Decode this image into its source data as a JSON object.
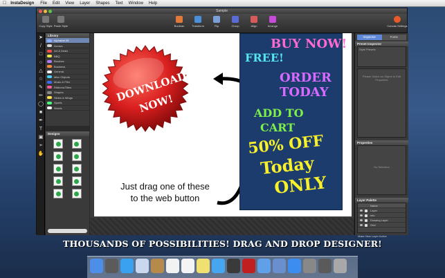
{
  "menubar": {
    "app_name": "InstaDesign",
    "items": [
      "File",
      "Edit",
      "View",
      "Layer",
      "Shapes",
      "Text",
      "Window",
      "Help"
    ]
  },
  "window": {
    "title": "Sample"
  },
  "toolbar": {
    "left_buttons": [
      "Copy Style",
      "Paste Style"
    ],
    "center_buttons": [
      "Boolean",
      "Transform",
      "Flip",
      "Group",
      "Align",
      "Arrange"
    ],
    "right_buttons": [
      "Canvas Settings"
    ]
  },
  "library": {
    "title": "Library",
    "items": [
      {
        "label": "Alphabet 09",
        "color": "#8fb1ff",
        "selected": true
      },
      {
        "label": "Arrows",
        "color": "#d4d4d4"
      },
      {
        "label": "Art & Deals",
        "color": "#ff4a4a"
      },
      {
        "label": "BBQ",
        "color": "#f0e24a"
      },
      {
        "label": "Brushes",
        "color": "#b07aff"
      },
      {
        "label": "Business",
        "color": "#ff8a3a"
      },
      {
        "label": "General",
        "color": "#ffffff"
      },
      {
        "label": "Misc Objects",
        "color": "#4ad0ff"
      },
      {
        "label": "Music & Film",
        "color": "#3a6aff"
      },
      {
        "label": "Ribbons/Titles",
        "color": "#ff5a9a"
      },
      {
        "label": "Shapes",
        "color": "#8a8a8a"
      },
      {
        "label": "Slides & Wings",
        "color": "#ffe24a"
      },
      {
        "label": "Sports",
        "color": "#4aff7a"
      },
      {
        "label": "Words",
        "color": "#ffffff"
      }
    ]
  },
  "designs": {
    "title": "Designs",
    "count": 10
  },
  "canvas": {
    "badge": {
      "line1": "DOWNLOAD",
      "line2": "NOW!"
    },
    "poster": {
      "lines": [
        "BUY NOW!",
        "FREE!",
        "ORDER",
        "TODAY",
        "ADD TO",
        "CART",
        "50% OFF",
        "Today",
        "ONLY"
      ]
    },
    "instruction": {
      "line1": "Just drag one of these",
      "line2": "to the web button"
    }
  },
  "inspector": {
    "tabs": [
      {
        "label": "Inspector",
        "active": true
      },
      {
        "label": "Fonts",
        "active": false
      }
    ],
    "preset_title": "Preset Inspector",
    "style_presets": "Style Presets",
    "select_hint": "Please Select an Object to Edit Properties",
    "properties_title": "Properties",
    "no_selection": "No Selection",
    "layers_title": "Layer Palette",
    "layers_column": "Name",
    "layers": [
      "Layer",
      "info",
      "Drawing Layer",
      "Grid"
    ],
    "new_layer_label": "Make New Layer Active"
  },
  "banner": {
    "text": "THOUSANDS OF POSSIBILITIES!  DRAG AND DROP DESIGNER!"
  },
  "dock": {
    "icons": [
      "finder-icon",
      "dashboard-icon",
      "safari-icon",
      "mail-icon",
      "contacts-icon",
      "calendar-icon",
      "notes-icon",
      "stickies-icon",
      "ichat-icon",
      "facetime-icon",
      "photobooth-icon",
      "itunes-icon",
      "preview-icon",
      "appstore-icon",
      "sysprefs-icon",
      "downloads-icon",
      "trash-icon"
    ],
    "colors": [
      "#4d8ee8",
      "#5b5b5b",
      "#3aa0f0",
      "#c9d8ee",
      "#b58a4a",
      "#f2f2f2",
      "#f4f4f4",
      "#f0e070",
      "#46a6f0",
      "#3a3a3a",
      "#c02020",
      "#5fa0e8",
      "#6a8fcf",
      "#3b8ef0",
      "#888888",
      "#5a5a5a",
      "#a8a8a8"
    ]
  }
}
